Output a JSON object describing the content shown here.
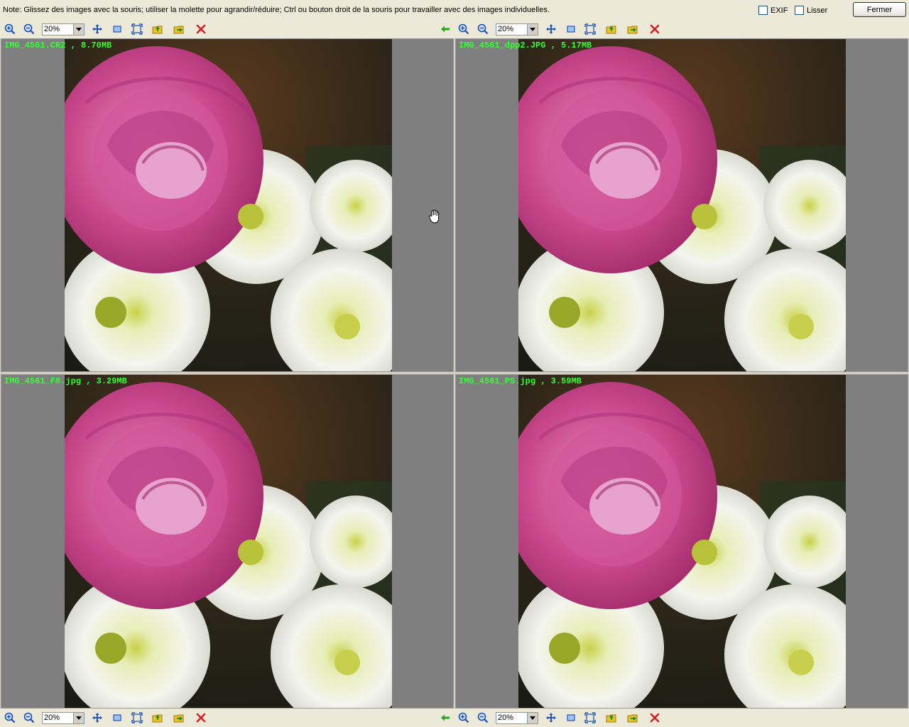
{
  "top": {
    "note": "Note: Glissez des images avec la souris; utiliser la molette pour agrandir/réduire; Ctrl ou bouton droit de la souris pour travailler avec des images individuelles.",
    "exif_label": "EXIF",
    "smooth_label": "Lisser",
    "close_label": "Fermer"
  },
  "toolbar": {
    "zoom_value": "20%",
    "icons": [
      "zoom-in-icon",
      "zoom-out-icon",
      "zoom-select",
      "move-icon",
      "actual-size-icon",
      "fit-icon",
      "open-folder-icon",
      "save-icon",
      "close-x-icon",
      "back-arrow-icon"
    ]
  },
  "panes": [
    {
      "caption": "IMG_4561.CR2 , 8.70MB"
    },
    {
      "caption": "IMG_4561_dpp2.JPG , 5.17MB"
    },
    {
      "caption": "IMG_4561_F8.jpg , 3.29MB"
    },
    {
      "caption": "IMG_4561_PS.jpg , 3.59MB"
    }
  ],
  "colors": {
    "caption": "#33ff33",
    "pane_bg": "#7f7f7f",
    "close_x": "#d42020",
    "back_arrow": "#22a822"
  }
}
